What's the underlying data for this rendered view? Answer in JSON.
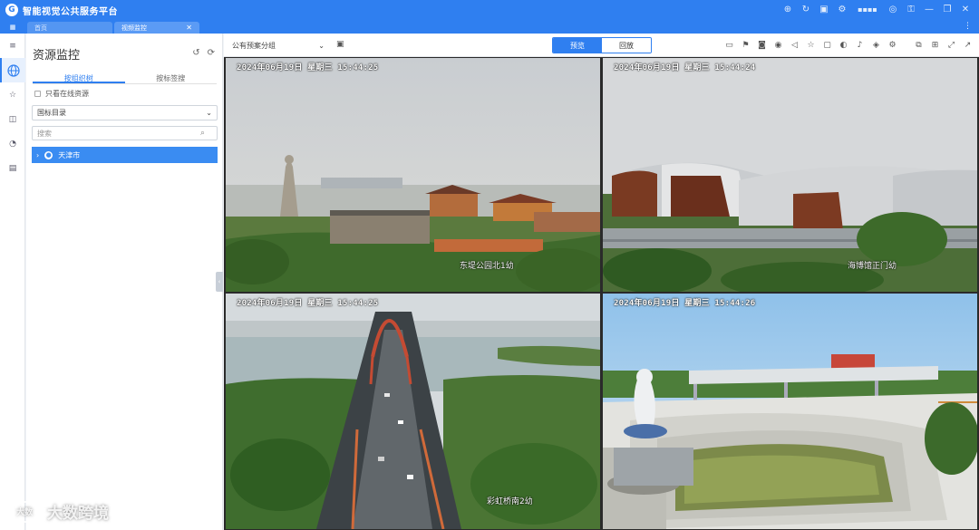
{
  "app": {
    "title": "智能视觉公共服务平台"
  },
  "titlebar": {
    "user": "▪▪▪▪"
  },
  "tabs": [
    {
      "label": "首页",
      "active": false
    },
    {
      "label": "视频监控",
      "active": true
    }
  ],
  "rail": [
    {
      "icon": "menu-icon"
    },
    {
      "icon": "globe-icon",
      "active": true
    },
    {
      "icon": "star-icon"
    },
    {
      "icon": "layout-icon"
    },
    {
      "icon": "chart-icon"
    },
    {
      "icon": "document-icon"
    }
  ],
  "panel": {
    "title": "资源监控",
    "subtabs": [
      "按组织树",
      "按标签搜"
    ],
    "online_only": "只看在线资源",
    "directory": "国标目录",
    "search_placeholder": "搜索",
    "tree_root": "天津市"
  },
  "toolbar": {
    "group": "公有预案分组",
    "preview": "预览",
    "playback": "回放"
  },
  "cameras": [
    {
      "time": "2024年06月19日  星期三  15:44:25",
      "label": "东堤公园北1幼"
    },
    {
      "time": "2024年06月19日  星期三  15:44:24",
      "label": "海博馆正门幼"
    },
    {
      "time": "2024年06月19日  星期三  15:44:25",
      "label": "彩虹桥南2幼"
    },
    {
      "time": "2024年06月19日  星期三  15:44:26",
      "label": ""
    }
  ],
  "watermark": {
    "logo": "大数",
    "text": "大数跨境"
  },
  "colors": {
    "brand": "#2f7ff0",
    "selected": "#3a8cf2"
  }
}
